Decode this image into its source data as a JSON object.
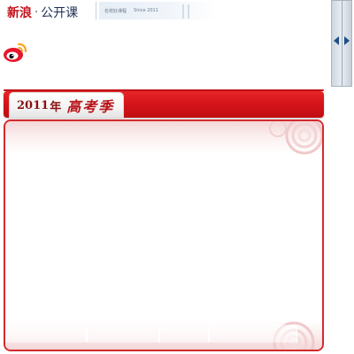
{
  "header": {
    "brand_sina": "新浪",
    "brand_dot": "·",
    "brand_course": "公开课",
    "strip_text": "名校好课程",
    "strip_since": "Since 2011"
  },
  "scroll": {
    "left_icon": "arrow-left-icon",
    "right_icon": "arrow-right-icon"
  },
  "title": {
    "year": "2011",
    "nian": "年",
    "subject": "高考季"
  },
  "colors": {
    "accent_red": "#d31318",
    "brand_navy": "#1e2f52",
    "panel_border": "#d32a2e",
    "arrow_blue": "#1d4f86"
  },
  "icons": {
    "logo": "weibo-logo-icon",
    "decoration": "swirl-decoration-icon"
  },
  "bottom_tabs": [
    "",
    "",
    "",
    ""
  ]
}
